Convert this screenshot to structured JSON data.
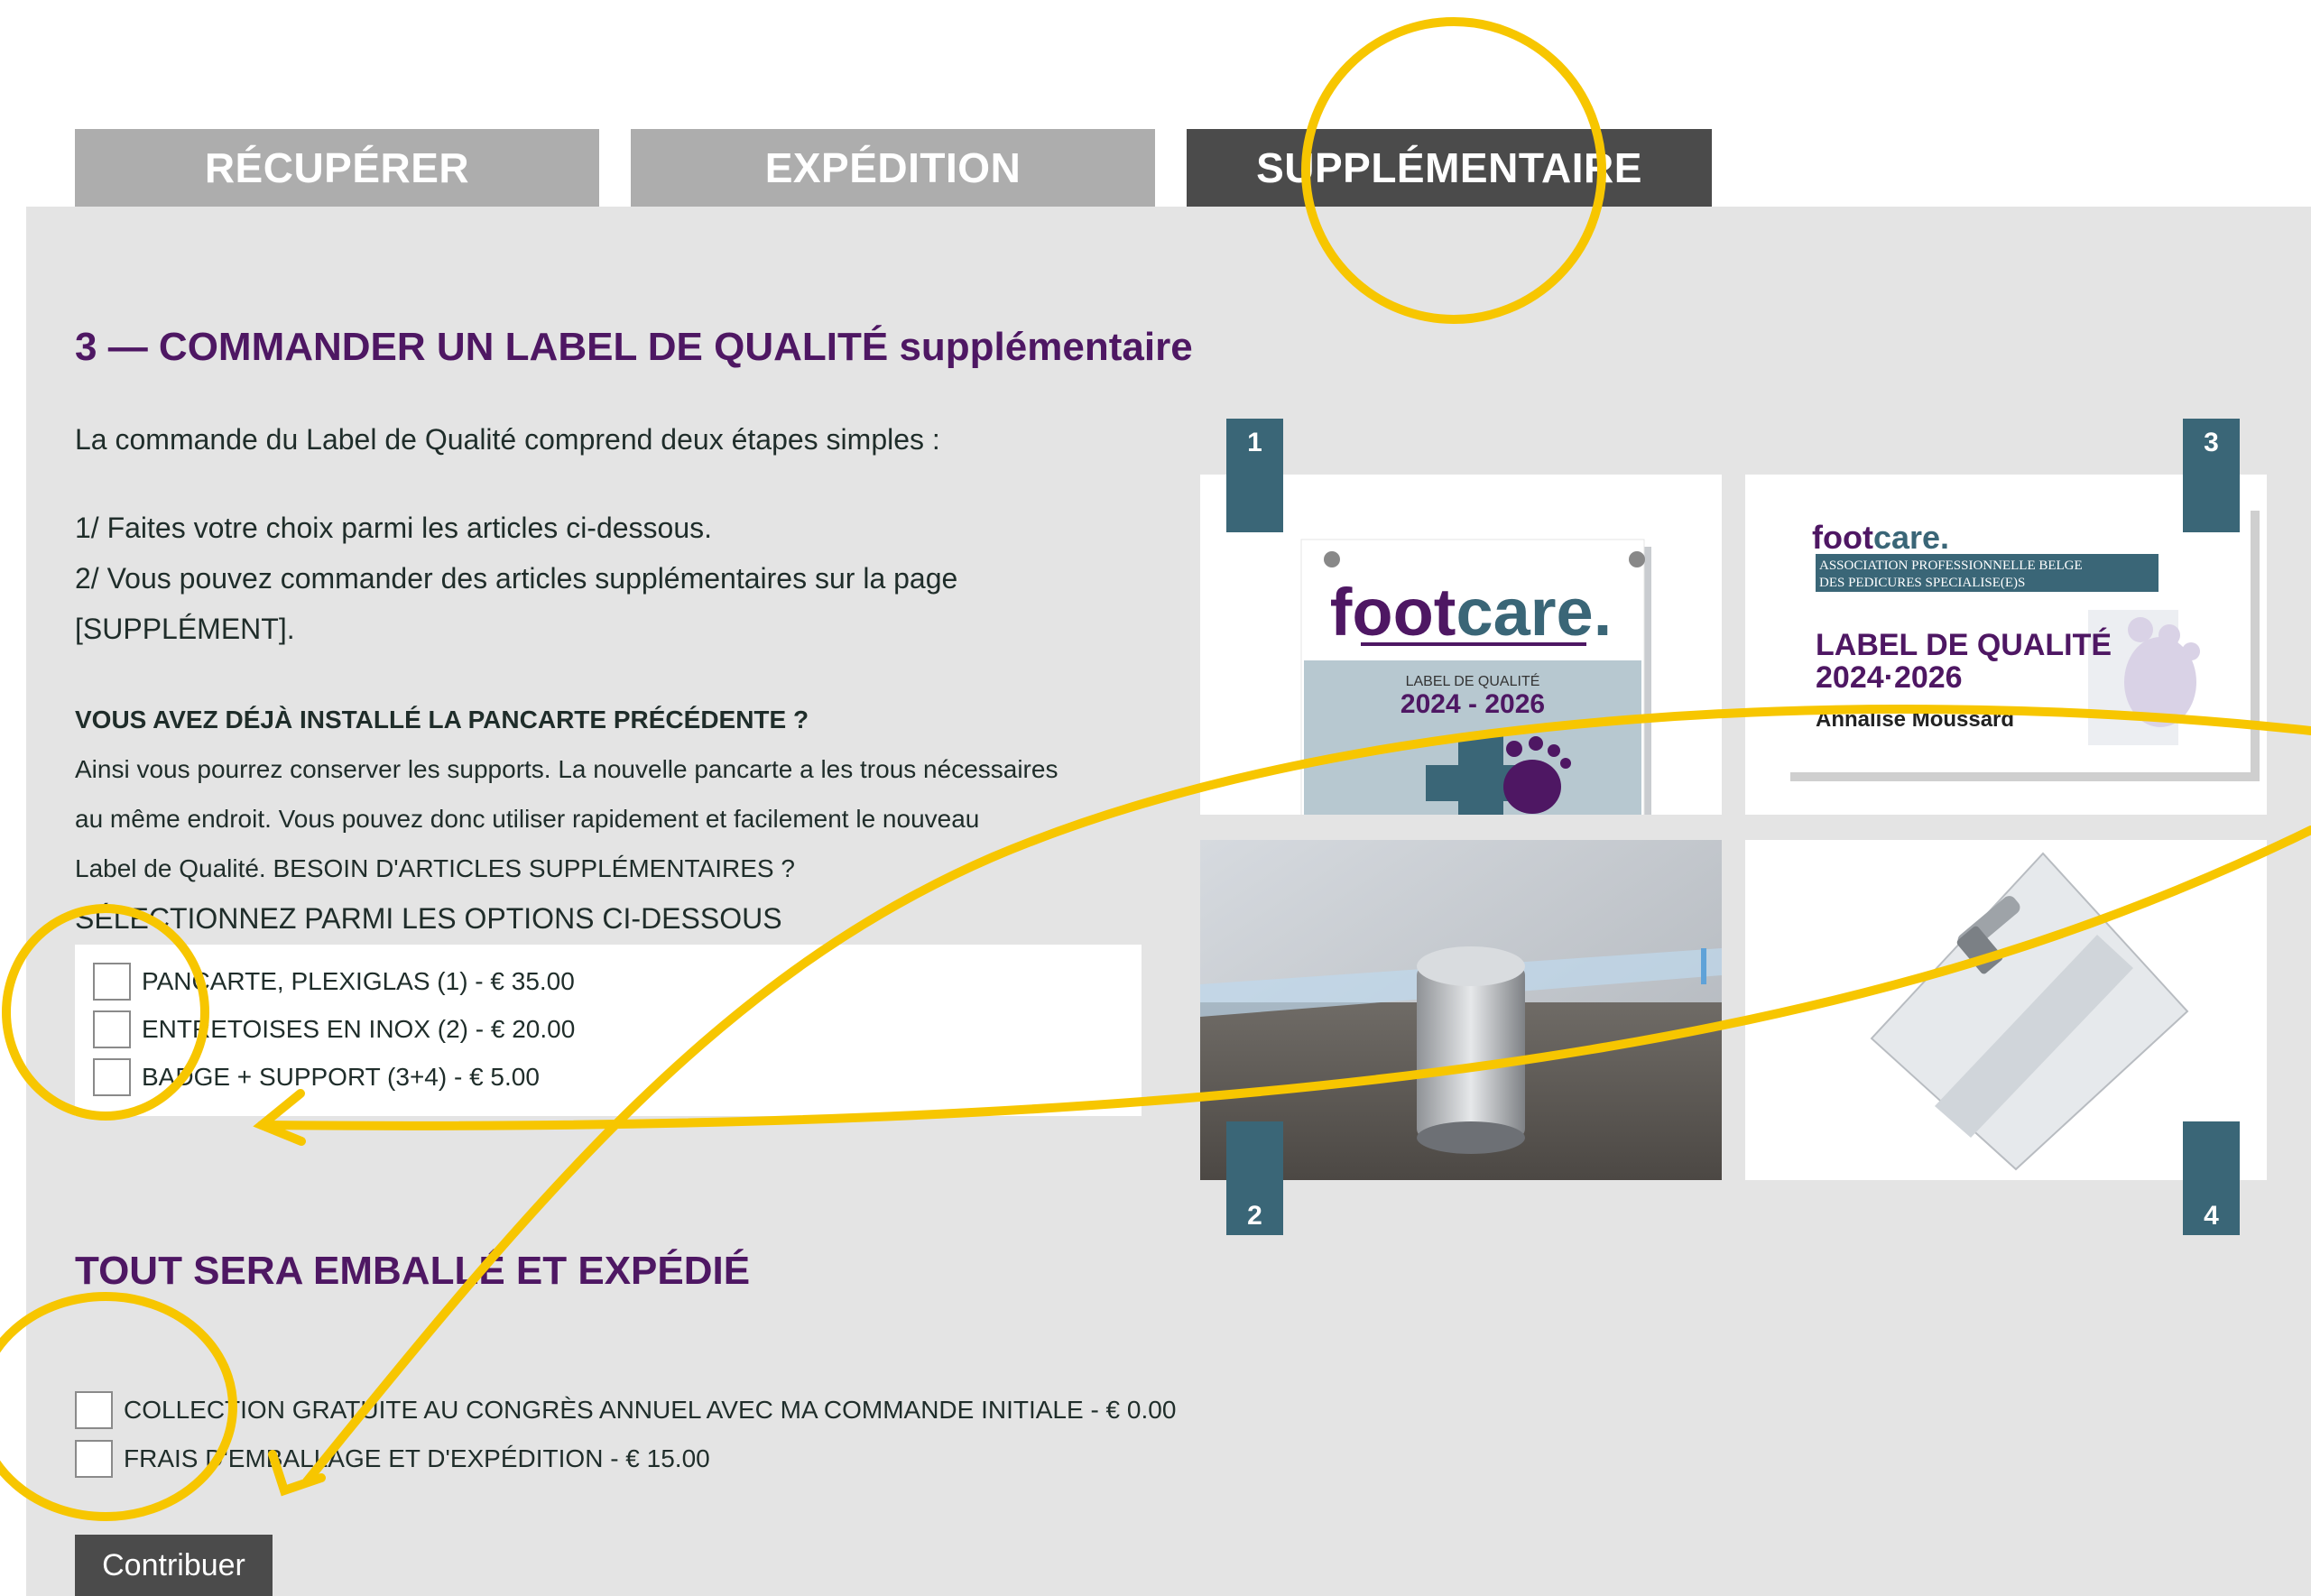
{
  "tabs": [
    {
      "label": "RÉCUPÉRER",
      "active": false
    },
    {
      "label": "EXPÉDITION",
      "active": false
    },
    {
      "label": "SUPPLÉMENTAIRE",
      "active": true
    }
  ],
  "section1": {
    "heading_main": "3 — COMMANDER UN LABEL DE QUALITÉ",
    "heading_suffix": "supplémentaire",
    "intro": "La commande du Label de Qualité comprend deux étapes simples :",
    "step1": "1/ Faites votre choix parmi les articles ci-dessous.",
    "step2_line1": "2/ Vous pouvez commander des articles supplémentaires sur la page",
    "step2_line2": "[SUPPLÉMENT].",
    "question": "VOUS AVEZ DÉJÀ INSTALLÉ LA PANCARTE PRÉCÉDENTE ?",
    "para_line1": "Ainsi vous pourrez conserver les supports. La nouvelle pancarte a les trous nécessaires",
    "para_line2": "au même endroit. Vous pouvez donc utiliser rapidement et facilement le nouveau",
    "para_line3": "Label de Qualité. BESOIN D'ARTICLES SUPPLÉMENTAIRES ?",
    "select_prompt": "SÉLECTIONNEZ PARMI LES OPTIONS CI-DESSOUS",
    "options": [
      {
        "label": "PANCARTE, PLEXIGLAS (1) - € 35.00",
        "checked": false
      },
      {
        "label": "ENTRETOISES EN INOX (2) - € 20.00",
        "checked": false
      },
      {
        "label": "BADGE + SUPPORT (3+4) - € 5.00",
        "checked": false
      }
    ]
  },
  "section2": {
    "heading": "TOUT SERA EMBALLÉ ET EXPÉDIÉ",
    "options": [
      {
        "label": "COLLECTION GRATUITE AU CONGRÈS ANNUEL AVEC MA COMMANDE INITIALE - € 0.00",
        "checked": false
      },
      {
        "label": "FRAIS D'EMBALLAGE ET D'EXPÉDITION - € 15.00",
        "checked": false
      }
    ]
  },
  "submit_label": "Contribuer",
  "gallery": {
    "badges": [
      "1",
      "2",
      "3",
      "4"
    ],
    "plaque": {
      "brand_foot": "foot",
      "brand_care": "care",
      "brand_dot": ".",
      "label_line": "LABEL DE QUALITÉ",
      "years": "2024 - 2026"
    },
    "badge_card": {
      "brand_foot": "foot",
      "brand_care": "care.",
      "assoc_line1": "ASSOCIATION PROFESSIONNELLE BELGE",
      "assoc_line2": "DES PEDICURES SPECIALISE(E)S",
      "label_line": "LABEL DE QUALITÉ",
      "years": "2024·2026",
      "name": "Annalise Moussard"
    }
  },
  "colors": {
    "heading_purple": "#4e1763",
    "badge_teal": "#3a6677",
    "annotation_yellow": "#f7c600",
    "tab_inactive": "#adadad",
    "tab_active": "#4b4b4b",
    "panel_bg": "#e4e4e4"
  }
}
